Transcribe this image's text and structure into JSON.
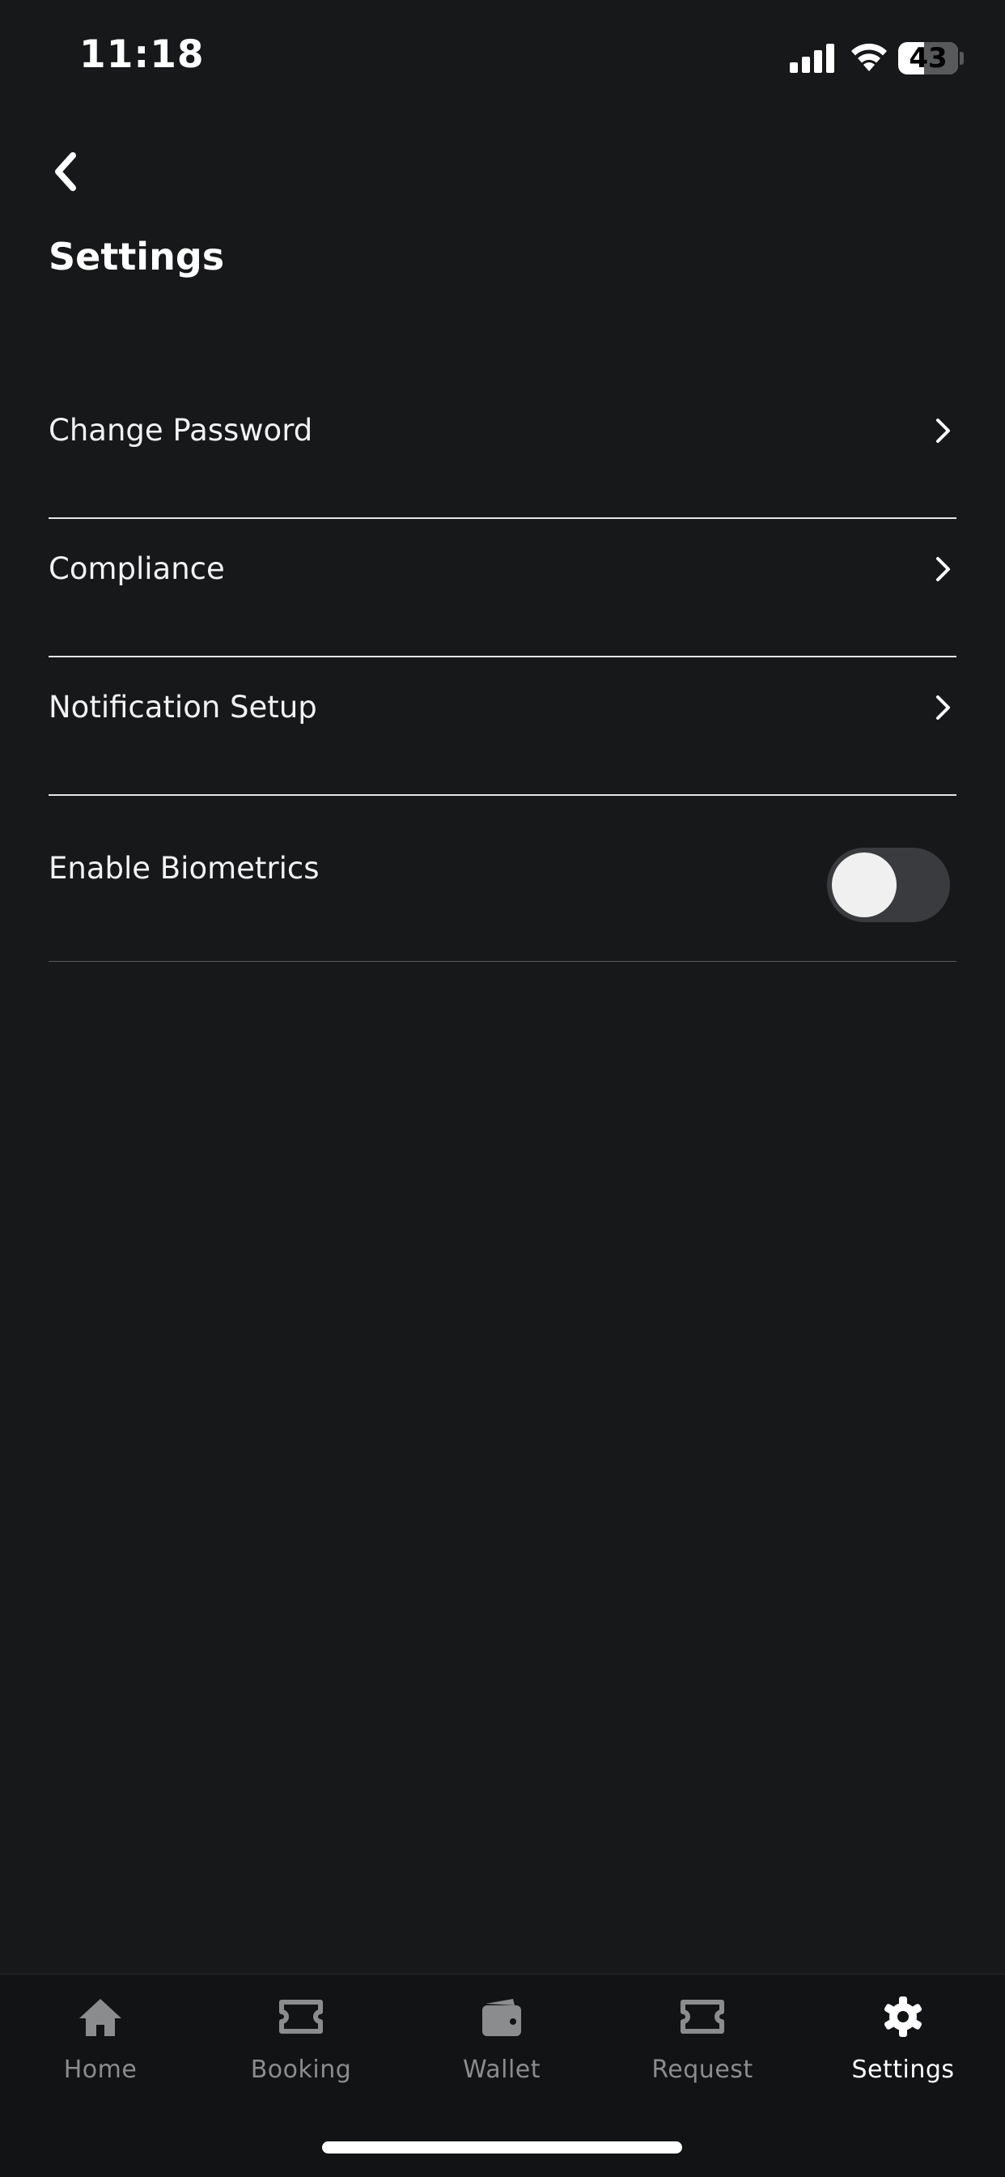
{
  "status_bar": {
    "time": "11:18",
    "battery_percent": "43",
    "battery_level": 0.43
  },
  "header": {
    "title": "Settings"
  },
  "settings": {
    "items": [
      {
        "label": "Change Password"
      },
      {
        "label": "Compliance"
      },
      {
        "label": "Notification Setup"
      }
    ],
    "biometrics": {
      "label": "Enable Biometrics",
      "enabled": false
    }
  },
  "tab_bar": {
    "tabs": [
      {
        "label": "Home",
        "icon": "home-icon"
      },
      {
        "label": "Booking",
        "icon": "ticket-icon"
      },
      {
        "label": "Wallet",
        "icon": "wallet-icon"
      },
      {
        "label": "Request",
        "icon": "ticket-icon"
      },
      {
        "label": "Settings",
        "icon": "gear-icon"
      }
    ],
    "active": "Settings"
  },
  "colors": {
    "background": "#17181a",
    "tab_bar_background": "#121314",
    "inactive_tab": "#8b8c8e",
    "active_tab": "#ffffff"
  }
}
